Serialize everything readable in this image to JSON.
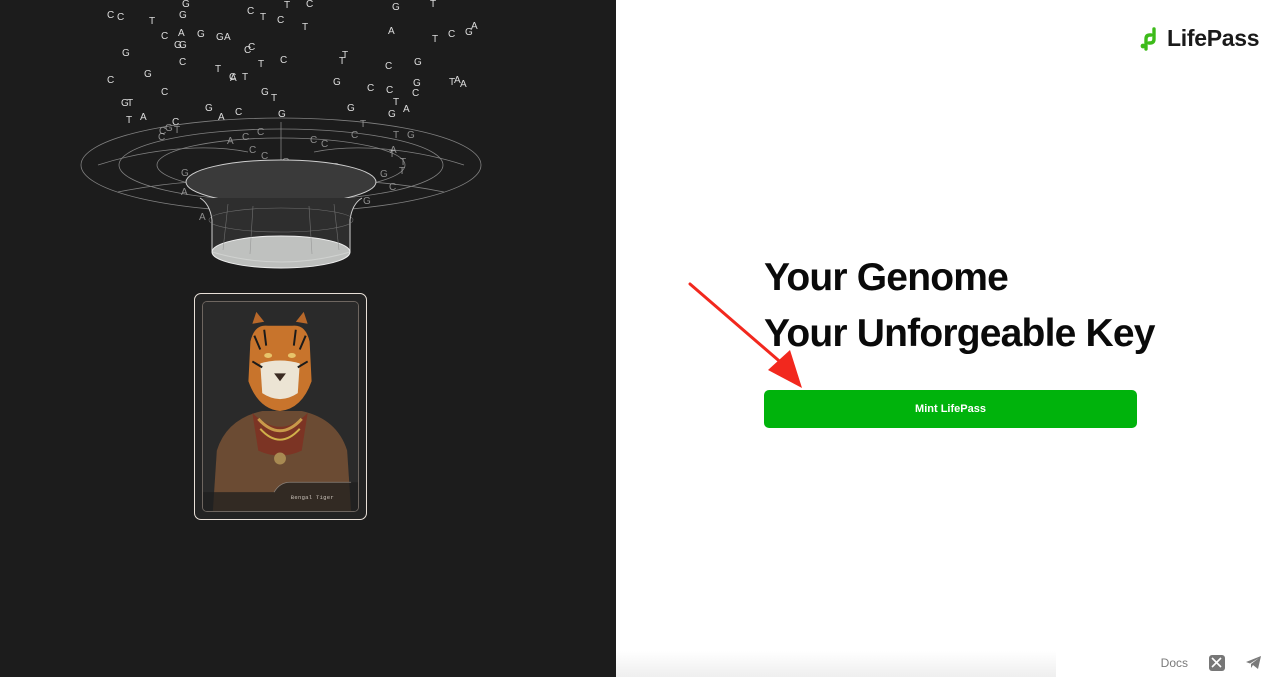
{
  "brand": {
    "name": "LifePass",
    "accent": "#00b30c"
  },
  "hero": {
    "line1": "Your Genome",
    "line2": "Your Unforgeable Key",
    "cta_label": "Mint LifePass"
  },
  "card": {
    "caption": "Bengal Tiger"
  },
  "footer": {
    "docs_label": "Docs",
    "icons": [
      "x-icon",
      "telegram-icon"
    ]
  },
  "dna_letters": [
    "C",
    "G",
    "T",
    "T",
    "C",
    "G",
    "C",
    "G",
    "T",
    "C",
    "C",
    "G",
    "T",
    "C",
    "T",
    "G",
    "A",
    "A",
    "G",
    "A",
    "A",
    "C",
    "T",
    "G",
    "C",
    "T",
    "G",
    "G",
    "C",
    "T",
    "T",
    "C",
    "G",
    "T",
    "C",
    "G",
    "C",
    "A",
    "G",
    "G",
    "C",
    "C",
    "T",
    "C",
    "T",
    "A",
    "G",
    "A",
    "C",
    "T",
    "C",
    "G",
    "C",
    "G",
    "A",
    "T",
    "T",
    "G",
    "G",
    "C",
    "A",
    "G",
    "C",
    "A",
    "T",
    "T",
    "C",
    "G",
    "C",
    "T",
    "C",
    "G",
    "C",
    "C",
    "T",
    "C",
    "A",
    "C",
    "C",
    "T",
    "C",
    "A",
    "G",
    "A",
    "T",
    "T",
    "C",
    "G",
    "T",
    "A",
    "G",
    "C",
    "C",
    "C",
    "A",
    "T",
    "A",
    "C",
    "T",
    "G",
    "T",
    "A",
    "G",
    "A",
    "C",
    "G",
    "G",
    "A",
    "T",
    "T",
    "A",
    "G",
    "C",
    "A",
    "A",
    "G",
    "A",
    "T",
    "A"
  ]
}
